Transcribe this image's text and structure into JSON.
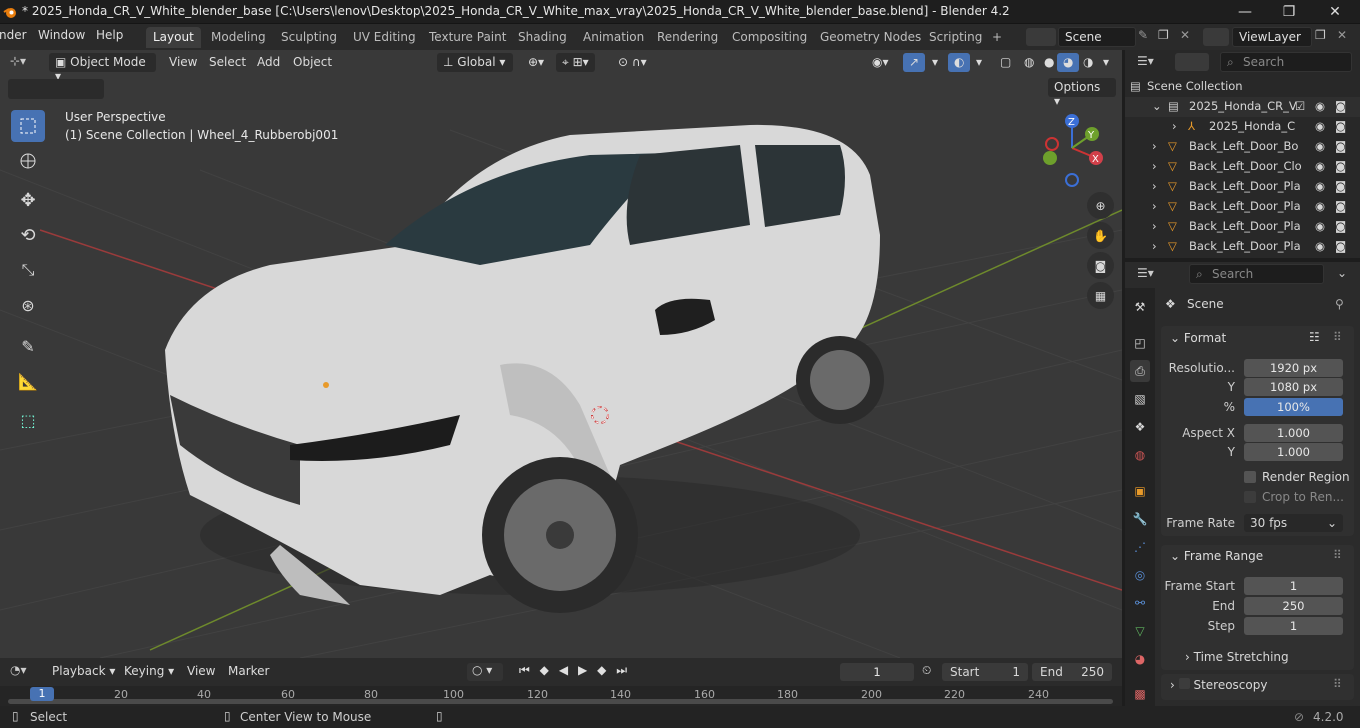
{
  "window": {
    "title": "* 2025_Honda_CR_V_White_blender_base [C:\\Users\\lenov\\Desktop\\2025_Honda_CR_V_White_max_vray\\2025_Honda_CR_V_White_blender_base.blend] - Blender 4.2",
    "minimize": "—",
    "maximize": "❐",
    "close": "✕"
  },
  "menus": [
    "nder",
    "Window",
    "Help"
  ],
  "workspaces": [
    "Layout",
    "Modeling",
    "Sculpting",
    "UV Editing",
    "Texture Paint",
    "Shading",
    "Animation",
    "Rendering",
    "Compositing",
    "Geometry Nodes",
    "Scripting"
  ],
  "add_workspace": "+",
  "scene": "Scene",
  "viewlayer": "ViewLayer",
  "viewport": {
    "mode": "Object Mode",
    "menus": [
      "View",
      "Select",
      "Add",
      "Object"
    ],
    "orientation": "Global",
    "options": "Options",
    "perspective": "User Perspective",
    "collection_info": "(1) Scene Collection | Wheel_4_Rubberobj001",
    "gizmo": {
      "x": "X",
      "y": "Y",
      "z": "Z"
    }
  },
  "outliner": {
    "search_placeholder": "Search",
    "root": "Scene Collection",
    "rows": [
      "2025_Honda_CR_V",
      "2025_Honda_C",
      "Back_Left_Door_Bo",
      "Back_Left_Door_Clo",
      "Back_Left_Door_Pla",
      "Back_Left_Door_Pla",
      "Back_Left_Door_Pla",
      "Back_Left_Door_Pla"
    ]
  },
  "properties": {
    "search_placeholder": "Search",
    "context": "Scene",
    "format": {
      "title": "Format",
      "resolution_label": "Resolutio...",
      "res_x": "1920 px",
      "y_label": "Y",
      "res_y": "1080 px",
      "pct_label": "%",
      "pct": "100%",
      "aspect_x_label": "Aspect X",
      "aspect_x": "1.000",
      "aspect_y_label": "Y",
      "aspect_y": "1.000",
      "render_region": "Render Region",
      "crop": "Crop to Ren...",
      "frame_rate_label": "Frame Rate",
      "frame_rate": "30 fps"
    },
    "frame_range": {
      "title": "Frame Range",
      "start_label": "Frame Start",
      "start": "1",
      "end_label": "End",
      "end": "250",
      "step_label": "Step",
      "step": "1",
      "time_stretching": "Time Stretching"
    },
    "stereoscopy": "Stereoscopy"
  },
  "timeline": {
    "menus": [
      "Playback",
      "Keying",
      "View",
      "Marker"
    ],
    "current_frame": "1",
    "start_label": "Start",
    "start": "1",
    "end_label": "End",
    "end": "250",
    "ticks": [
      "1",
      "20",
      "40",
      "60",
      "80",
      "100",
      "120",
      "140",
      "160",
      "180",
      "200",
      "220",
      "240"
    ]
  },
  "status": {
    "select": "Select",
    "center": "Center View to Mouse",
    "version": "4.2.0"
  },
  "colors": {
    "accent": "#4772b3",
    "viewport": "#393939",
    "car_body": "#d9d9d9"
  }
}
